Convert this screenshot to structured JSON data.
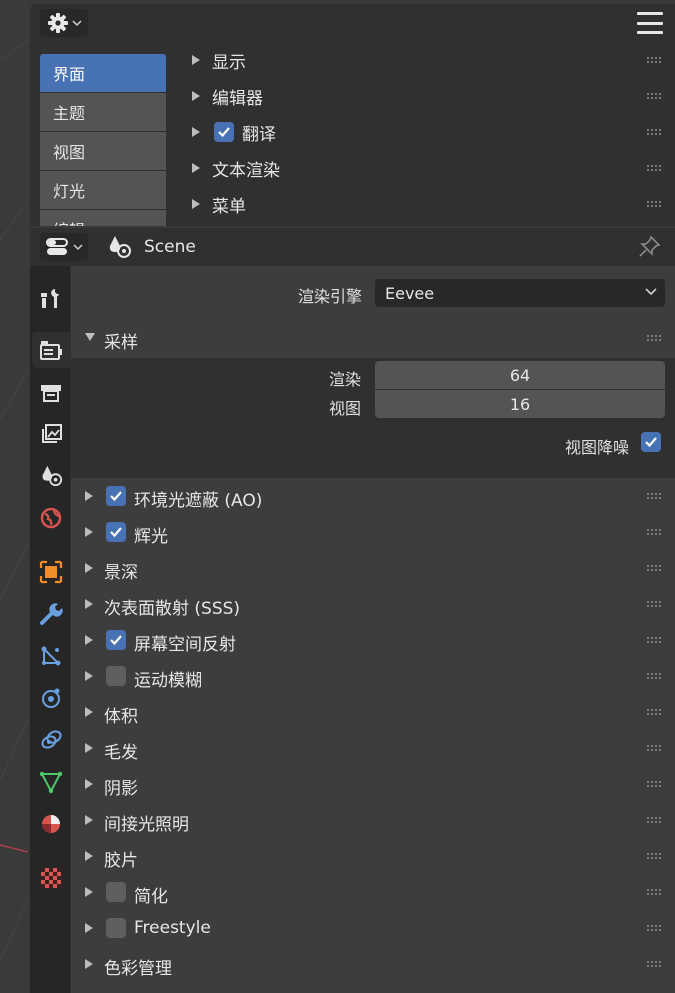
{
  "preferences": {
    "tabs": [
      "界面",
      "主题",
      "视图",
      "灯光",
      "编辑"
    ],
    "active_tab": 0,
    "sections": [
      {
        "label": "显示",
        "checkbox": null
      },
      {
        "label": "编辑器",
        "checkbox": null
      },
      {
        "label": "翻译",
        "checkbox": true
      },
      {
        "label": "文本渲染",
        "checkbox": null
      },
      {
        "label": "菜单",
        "checkbox": null
      }
    ]
  },
  "properties": {
    "context_title": "Scene",
    "render_engine_label": "渲染引擎",
    "render_engine_value": "Eevee",
    "sampling": {
      "title": "采样",
      "render_label": "渲染",
      "render_value": "64",
      "viewport_label": "视图",
      "viewport_value": "16",
      "denoise_label": "视图降噪",
      "denoise_checked": true
    },
    "panels": [
      {
        "label": "环境光遮蔽 (AO)",
        "checkbox": true
      },
      {
        "label": "辉光",
        "checkbox": true
      },
      {
        "label": "景深",
        "checkbox": null
      },
      {
        "label": "次表面散射 (SSS)",
        "checkbox": null
      },
      {
        "label": "屏幕空间反射",
        "checkbox": true
      },
      {
        "label": "运动模糊",
        "checkbox": false
      },
      {
        "label": "体积",
        "checkbox": null
      },
      {
        "label": "毛发",
        "checkbox": null
      },
      {
        "label": "阴影",
        "checkbox": null
      },
      {
        "label": "间接光照明",
        "checkbox": null
      },
      {
        "label": "胶片",
        "checkbox": null
      },
      {
        "label": "简化",
        "checkbox": false
      },
      {
        "label": "Freestyle",
        "checkbox": false
      },
      {
        "label": "色彩管理",
        "checkbox": null
      }
    ],
    "property_tabs": [
      "tool-icon",
      "render-icon",
      "output-icon",
      "view-layer-icon",
      "scene-icon",
      "world-icon",
      "object-icon",
      "modifier-icon",
      "particles-icon",
      "physics-icon",
      "constraints-icon",
      "data-icon",
      "material-icon",
      "texture-icon"
    ],
    "active_property_tab": "render-icon"
  },
  "colors": {
    "accent": "#4772b3",
    "panel_bg": "#3d3d3d",
    "header_bg": "#303030"
  }
}
